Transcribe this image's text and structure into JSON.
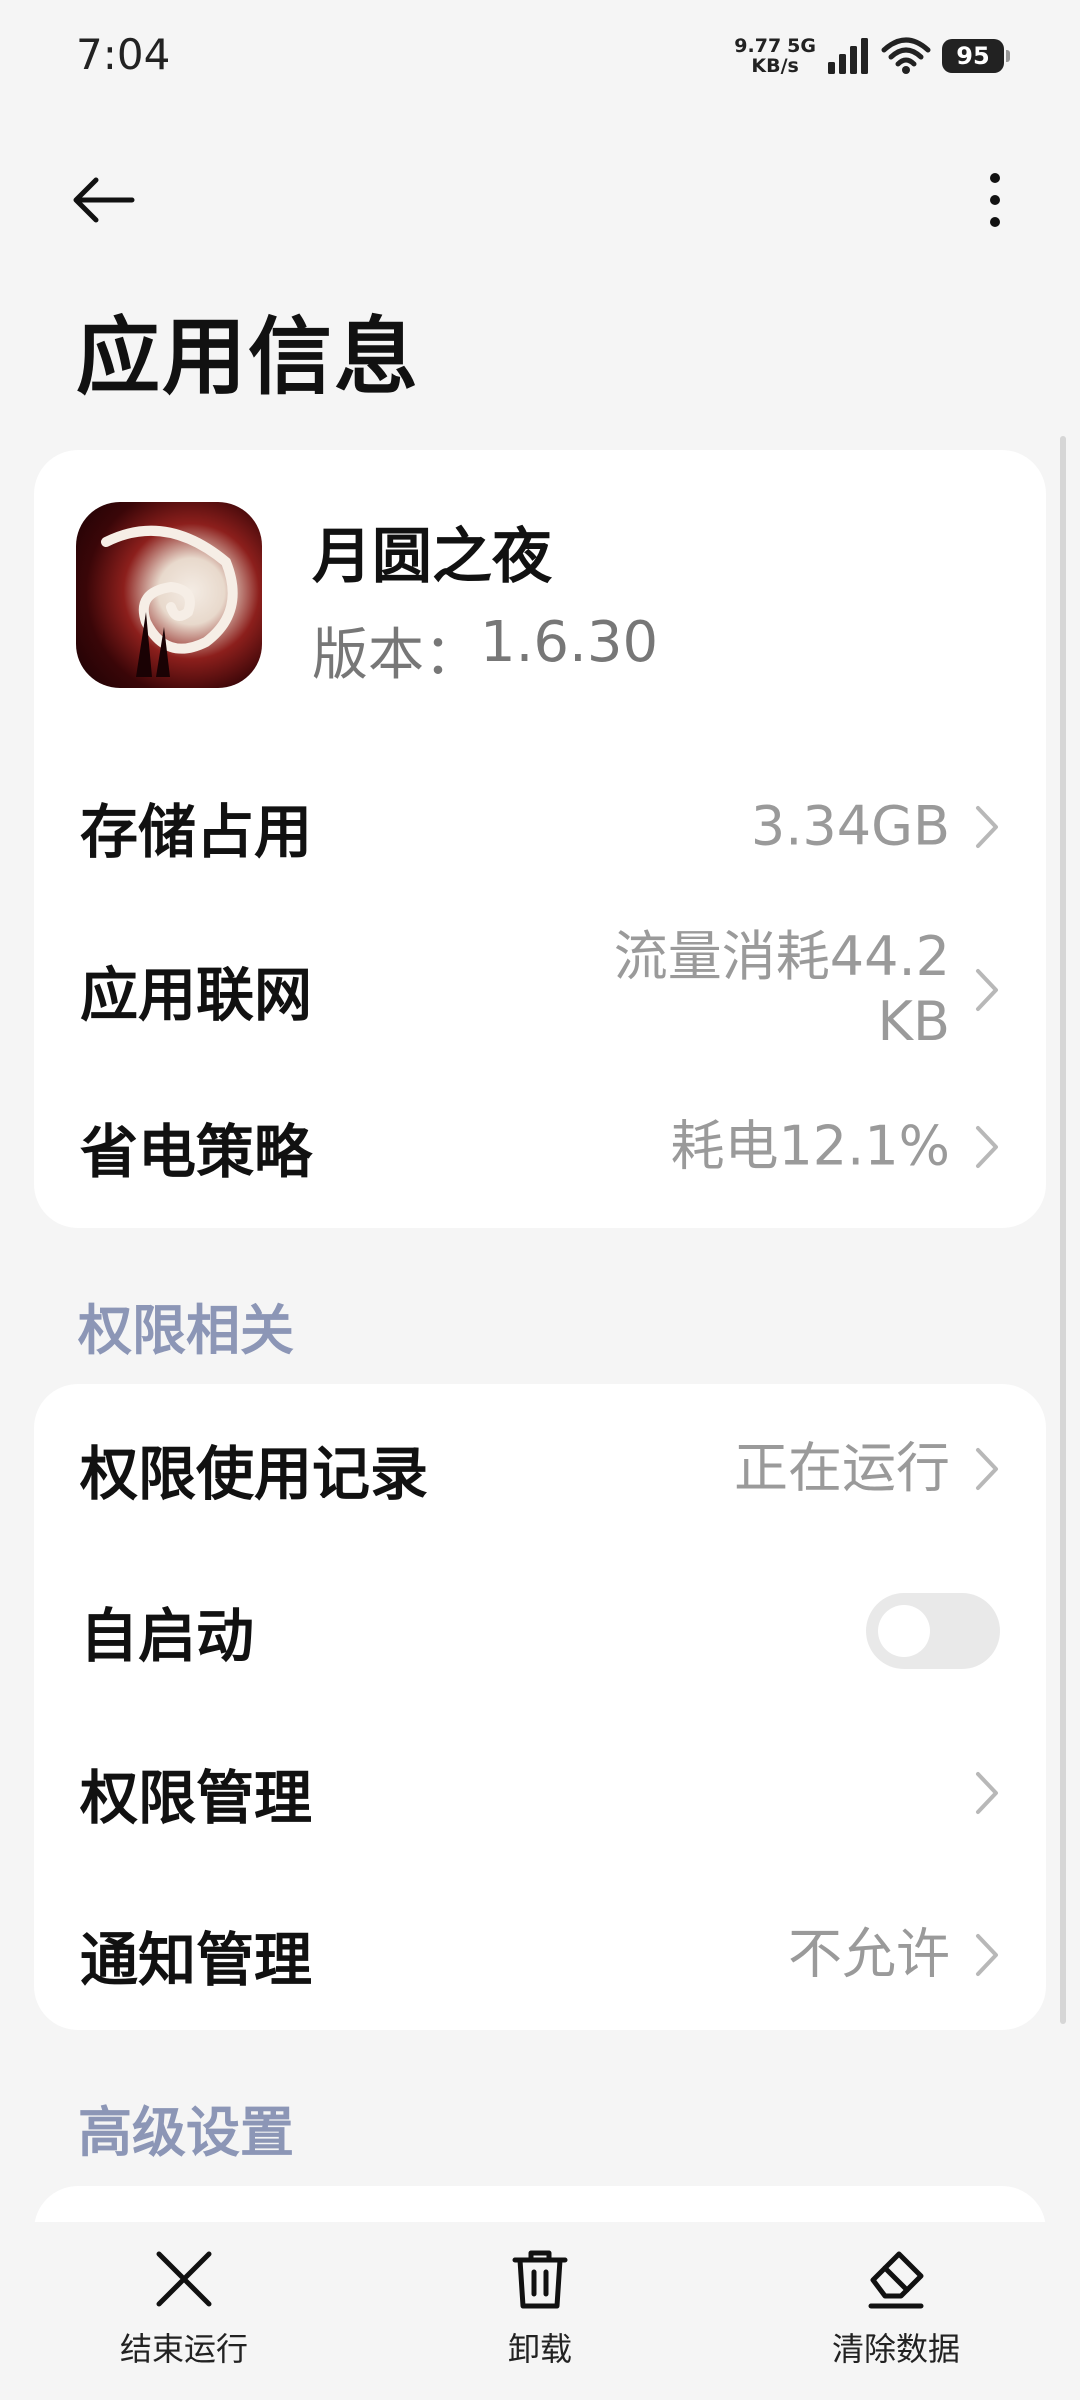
{
  "status_bar": {
    "time": "7:04",
    "net_speed_value": "9.77",
    "net_speed_unit": "KB/s",
    "network_type": "5G",
    "battery": "95"
  },
  "header": {
    "title": "应用信息"
  },
  "app": {
    "name": "月圆之夜",
    "version_label": "版本：",
    "version": "1.6.30"
  },
  "info_rows": [
    {
      "label": "存储占用",
      "value": "3.34GB"
    },
    {
      "label": "应用联网",
      "value": "流量消耗44.2 KB"
    },
    {
      "label": "省电策略",
      "value": "耗电12.1%"
    }
  ],
  "permissions": {
    "section_title": "权限相关",
    "usage_label": "权限使用记录",
    "usage_value": "正在运行",
    "autostart_label": "自启动",
    "autostart_enabled": false,
    "manage_label": "权限管理",
    "notify_label": "通知管理",
    "notify_value": "不允许"
  },
  "advanced": {
    "section_title": "高级设置"
  },
  "bottom_bar": {
    "force_stop": "结束运行",
    "uninstall": "卸载",
    "clear_data": "清除数据"
  },
  "icons": {
    "back": "back-arrow-icon",
    "more": "more-vertical-icon",
    "chevron": "chevron-right-icon",
    "force_stop": "close-icon",
    "uninstall": "trash-icon",
    "clear_data": "eraser-icon"
  }
}
